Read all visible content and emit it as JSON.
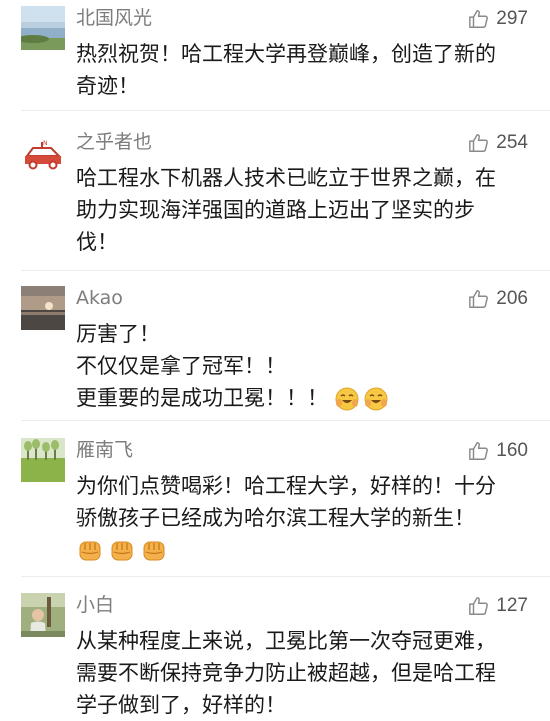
{
  "comments": [
    {
      "username": "北国风光",
      "likes": "297",
      "lines": [
        "热烈祝贺！哈工程大学再登巅峰，创造了新的",
        "奇迹！"
      ],
      "avatar": "lakeside-landscape"
    },
    {
      "username": "之乎者也",
      "likes": "254",
      "lines": [
        "哈工程水下机器人技术已屹立于世界之巅，在",
        "助力实现海洋强国的道路上迈出了坚实的步",
        "伐！"
      ],
      "avatar": "red-car-drawing"
    },
    {
      "username": "Akao",
      "likes": "206",
      "lines": [
        "厉害了！",
        "不仅仅是拿了冠军！！",
        "更重要的是成功卫冕！！！"
      ],
      "avatar": "sunset-over-sea",
      "emoji": [
        "laughing-emoji",
        "laughing-emoji"
      ]
    },
    {
      "username": "雁南飞",
      "likes": "160",
      "lines": [
        "为你们点赞喝彩！哈工程大学，好样的！十分",
        "骄傲孩子已经成为哈尔滨工程大学的新生！"
      ],
      "avatar": "green-field-trees",
      "emoji": [
        "fist-emoji",
        "fist-emoji",
        "fist-emoji"
      ]
    },
    {
      "username": "小白",
      "likes": "127",
      "lines": [
        "从某种程度上来说，卫冕比第一次夺冠更难，",
        "需要不断保持竞争力防止被超越，但是哈工程",
        "学子做到了，好样的！"
      ],
      "avatar": "person-portrait"
    }
  ],
  "icons": {
    "like": "thumbs-up-outline-icon"
  },
  "colors": {
    "username": "#7d7d7d",
    "text": "#1a1a1a",
    "like_icon": "#8a8a8a"
  }
}
